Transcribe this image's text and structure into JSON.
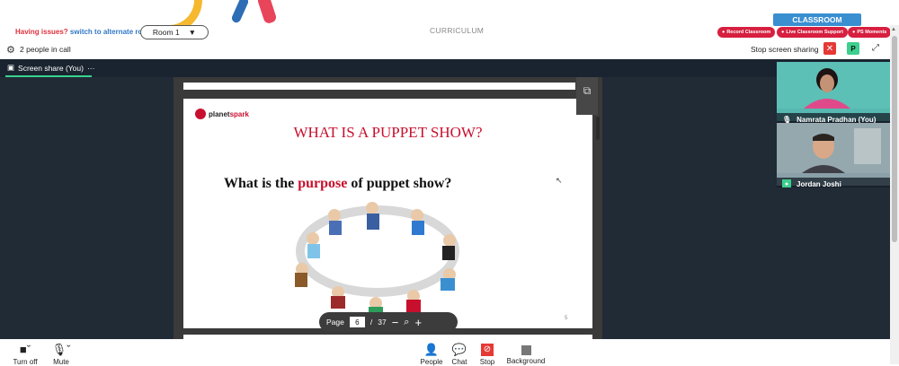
{
  "banner": {
    "issues_text": "Having issues?",
    "alternate_link": "switch to alternate room",
    "room_label": "Room 1",
    "curriculum": "CURRICULUM",
    "classroom": "CLASSROOM",
    "pills": [
      "Record Classroom",
      "Live Classroom Support",
      "PS Moments"
    ]
  },
  "call": {
    "people_count": "2 people in call",
    "stop_share": "Stop screen sharing",
    "avatar_letter": "P"
  },
  "share": {
    "tab_label": "Screen share (You)",
    "tab_menu": "···"
  },
  "slide": {
    "logo_main": "planet",
    "logo_accent": "spark",
    "title": "WHAT IS A PUPPET SHOW?",
    "question_before": "What is the ",
    "question_accent": "purpose",
    "question_after": " of puppet show?",
    "page_number": "5"
  },
  "pager": {
    "label": "Page",
    "current": "6",
    "separator": "/",
    "total": "37"
  },
  "participants": [
    {
      "name": "Namrata Pradhan (You)"
    },
    {
      "name": "Jordan Joshi"
    }
  ],
  "controls": {
    "turn_off": "Turn off",
    "mute": "Mute",
    "people": "People",
    "chat": "Chat",
    "stop": "Stop",
    "background": "Background"
  },
  "colors": {
    "accent_red": "#c8102e",
    "classroom_blue": "#3a8fd1",
    "active_green": "#39d28f"
  }
}
